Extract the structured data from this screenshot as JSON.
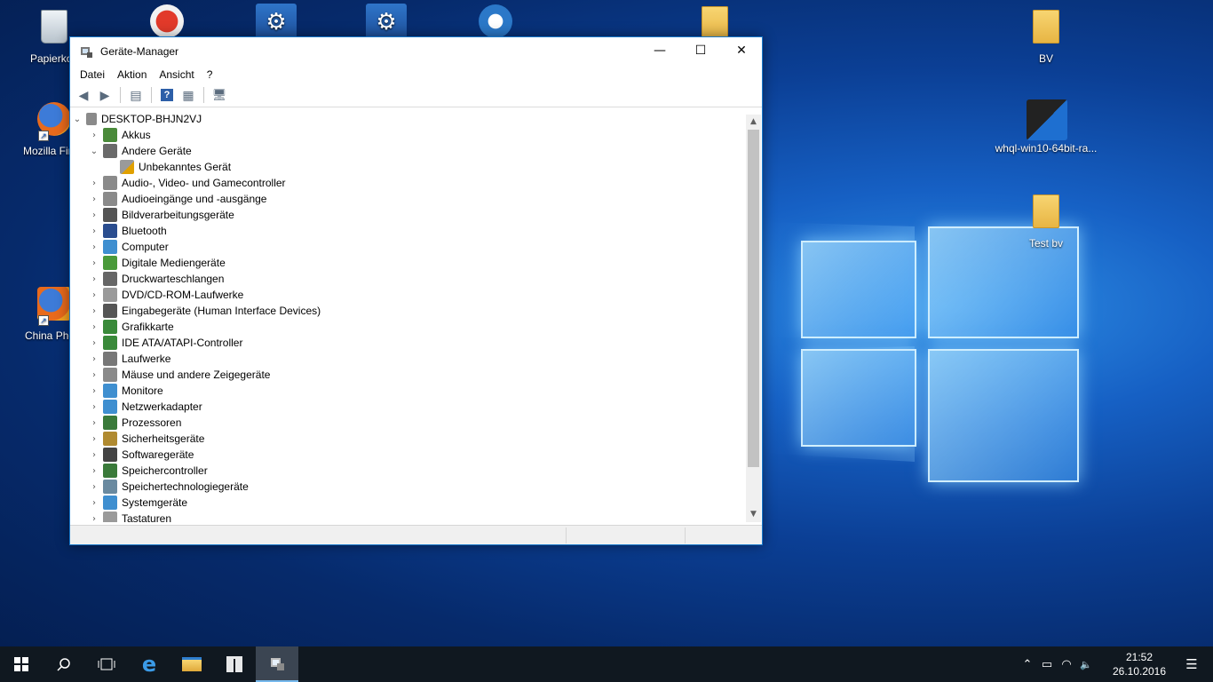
{
  "desktop": {
    "icons": [
      {
        "label": "Papierkorb",
        "icon": "recycle-bin-icon"
      },
      {
        "label": "Mozilla Firefox",
        "icon": "firefox-icon"
      },
      {
        "label": "China Phone",
        "icon": "firefox-icon"
      },
      {
        "label": "BV",
        "icon": "folder-icon"
      },
      {
        "label": "whql-win10-64bit-ra...",
        "icon": "installer-icon"
      },
      {
        "label": "Test bv",
        "icon": "folder-icon"
      }
    ]
  },
  "window": {
    "title": "Geräte-Manager",
    "menu": [
      "Datei",
      "Aktion",
      "Ansicht",
      "?"
    ],
    "caption": {
      "minimize": "—",
      "maximize": "☐",
      "close": "✕"
    },
    "toolbar": {
      "back": "◀",
      "forward": "▶",
      "properties": "▤",
      "help": "?",
      "update": "▦",
      "scan": "🖥"
    },
    "tree": {
      "root": "DESKTOP-BHJN2VJ",
      "items": [
        {
          "label": "Akkus",
          "expanded": false,
          "color": "#4a8a3a"
        },
        {
          "label": "Andere Geräte",
          "expanded": true,
          "color": "#6a6a6a",
          "children": [
            {
              "label": "Unbekanntes Gerät",
              "color": "#e0a000"
            }
          ]
        },
        {
          "label": "Audio-, Video- und Gamecontroller",
          "expanded": false,
          "color": "#8a8a8a"
        },
        {
          "label": "Audioeingänge und -ausgänge",
          "expanded": false,
          "color": "#8a8a8a"
        },
        {
          "label": "Bildverarbeitungsgeräte",
          "expanded": false,
          "color": "#555555"
        },
        {
          "label": "Bluetooth",
          "expanded": false,
          "color": "#2a4d8f"
        },
        {
          "label": "Computer",
          "expanded": false,
          "color": "#3f8fd0"
        },
        {
          "label": "Digitale Mediengeräte",
          "expanded": false,
          "color": "#4a9a3a"
        },
        {
          "label": "Druckwarteschlangen",
          "expanded": false,
          "color": "#666666"
        },
        {
          "label": "DVD/CD-ROM-Laufwerke",
          "expanded": false,
          "color": "#9a9a9a"
        },
        {
          "label": "Eingabegeräte (Human Interface Devices)",
          "expanded": false,
          "color": "#555555"
        },
        {
          "label": "Grafikkarte",
          "expanded": false,
          "color": "#3a8a3a"
        },
        {
          "label": "IDE ATA/ATAPI-Controller",
          "expanded": false,
          "color": "#3a8a3a"
        },
        {
          "label": "Laufwerke",
          "expanded": false,
          "color": "#777777"
        },
        {
          "label": "Mäuse und andere Zeigegeräte",
          "expanded": false,
          "color": "#8a8a8a"
        },
        {
          "label": "Monitore",
          "expanded": false,
          "color": "#3f8fd0"
        },
        {
          "label": "Netzwerkadapter",
          "expanded": false,
          "color": "#3f8fd0"
        },
        {
          "label": "Prozessoren",
          "expanded": false,
          "color": "#3a7a3a"
        },
        {
          "label": "Sicherheitsgeräte",
          "expanded": false,
          "color": "#b08a30"
        },
        {
          "label": "Softwaregeräte",
          "expanded": false,
          "color": "#444444"
        },
        {
          "label": "Speichercontroller",
          "expanded": false,
          "color": "#3a7a3a"
        },
        {
          "label": "Speichertechnologiegeräte",
          "expanded": false,
          "color": "#6a8aa0"
        },
        {
          "label": "Systemgeräte",
          "expanded": false,
          "color": "#3f8fd0"
        },
        {
          "label": "Tastaturen",
          "expanded": false,
          "color": "#9a9a9a"
        }
      ]
    }
  },
  "taskbar": {
    "buttons": [
      {
        "name": "start-button",
        "icon": "windows-logo-icon",
        "glyph": "⊞"
      },
      {
        "name": "search-button",
        "icon": "search-icon",
        "glyph": "⚲"
      },
      {
        "name": "task-view-button",
        "icon": "task-view-icon",
        "glyph": "❐"
      },
      {
        "name": "edge-button",
        "icon": "edge-icon",
        "glyph": "e"
      },
      {
        "name": "explorer-button",
        "icon": "folder-icon",
        "glyph": "▬"
      },
      {
        "name": "store-button",
        "icon": "store-icon",
        "glyph": "⊞"
      },
      {
        "name": "device-manager-button",
        "icon": "device-manager-icon",
        "glyph": "▣"
      }
    ],
    "tray": {
      "chevron": "⌃",
      "battery": "▭",
      "network": "◠",
      "volume": "🔈",
      "time": "21:52",
      "date": "26.10.2016",
      "notifications": "☰"
    }
  }
}
